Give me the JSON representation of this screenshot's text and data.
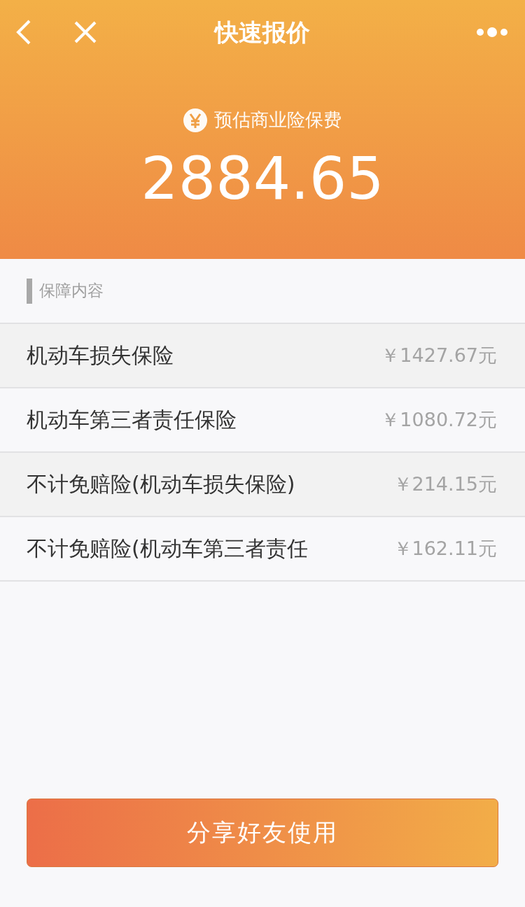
{
  "nav": {
    "title": "快速报价"
  },
  "summary": {
    "label": "预估商业险保费",
    "amount": "2884.65"
  },
  "section": {
    "title": "保障内容"
  },
  "items": [
    {
      "name": "机动车损失保险",
      "price": "￥1427.67元"
    },
    {
      "name": "机动车第三者责任保险",
      "price": "￥1080.72元"
    },
    {
      "name": "不计免赔险(机动车损失保险)",
      "price": "￥214.15元"
    },
    {
      "name": "不计免赔险(机动车第三者责任",
      "price": "￥162.11元"
    }
  ],
  "button": {
    "label": "分享好友使用"
  }
}
